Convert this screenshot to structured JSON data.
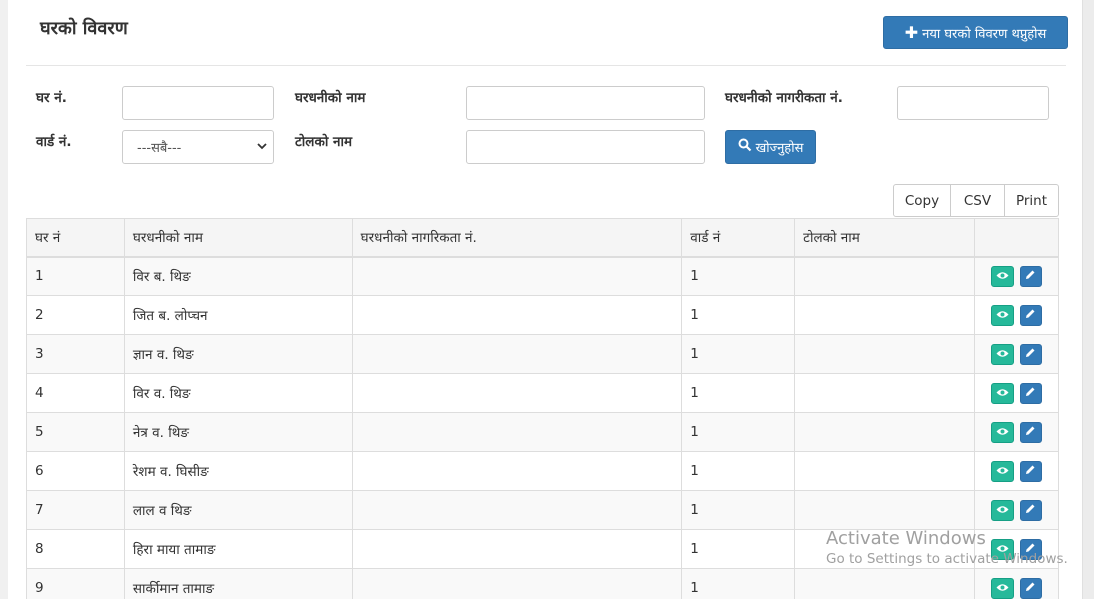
{
  "page": {
    "title": "घरको विवरण",
    "add_button_label": "नया घरको विवरण थप्नुहोस"
  },
  "filters": {
    "house_no_label": "घर नं.",
    "owner_name_label": "घरधनीको नाम",
    "citizenship_label": "घरधनीको नागरीकता नं.",
    "ward_label": "वार्ड नं.",
    "ward_selected": "---सबै---",
    "tole_label": "टोलको नाम",
    "search_button_label": "खोज्नुहोस"
  },
  "export": {
    "copy": "Copy",
    "csv": "CSV",
    "print": "Print"
  },
  "table": {
    "columns": [
      "घर नं",
      "घरधनीको नाम",
      "घरधनीको नागरिकता नं.",
      "वार्ड नं",
      "टोलको नाम",
      ""
    ],
    "rows": [
      {
        "house_no": "1",
        "owner": "विर ब. थिङ",
        "citizenship": "",
        "ward": "1",
        "tole": ""
      },
      {
        "house_no": "2",
        "owner": "जित ब. लोप्चन",
        "citizenship": "",
        "ward": "1",
        "tole": ""
      },
      {
        "house_no": "3",
        "owner": "ज्ञान व. थिङ",
        "citizenship": "",
        "ward": "1",
        "tole": ""
      },
      {
        "house_no": "4",
        "owner": "विर व. थिङ",
        "citizenship": "",
        "ward": "1",
        "tole": ""
      },
      {
        "house_no": "5",
        "owner": "नेत्र व. थिङ",
        "citizenship": "",
        "ward": "1",
        "tole": ""
      },
      {
        "house_no": "6",
        "owner": "रेशम व. घिसीङ",
        "citizenship": "",
        "ward": "1",
        "tole": ""
      },
      {
        "house_no": "7",
        "owner": "लाल व थिङ",
        "citizenship": "",
        "ward": "1",
        "tole": ""
      },
      {
        "house_no": "8",
        "owner": "हिरा माया तामाङ",
        "citizenship": "",
        "ward": "1",
        "tole": ""
      },
      {
        "house_no": "9",
        "owner": "सार्कीमान तामाङ",
        "citizenship": "",
        "ward": "1",
        "tole": ""
      }
    ]
  },
  "watermark": {
    "line1": "Activate Windows",
    "line2": "Go to Settings to activate Windows."
  },
  "colors": {
    "primary": "#337ab7",
    "view_button": "#26b99a"
  },
  "icons": {
    "add": "plus-icon",
    "search": "search-icon",
    "view": "eye-icon",
    "edit": "pencil-icon"
  }
}
